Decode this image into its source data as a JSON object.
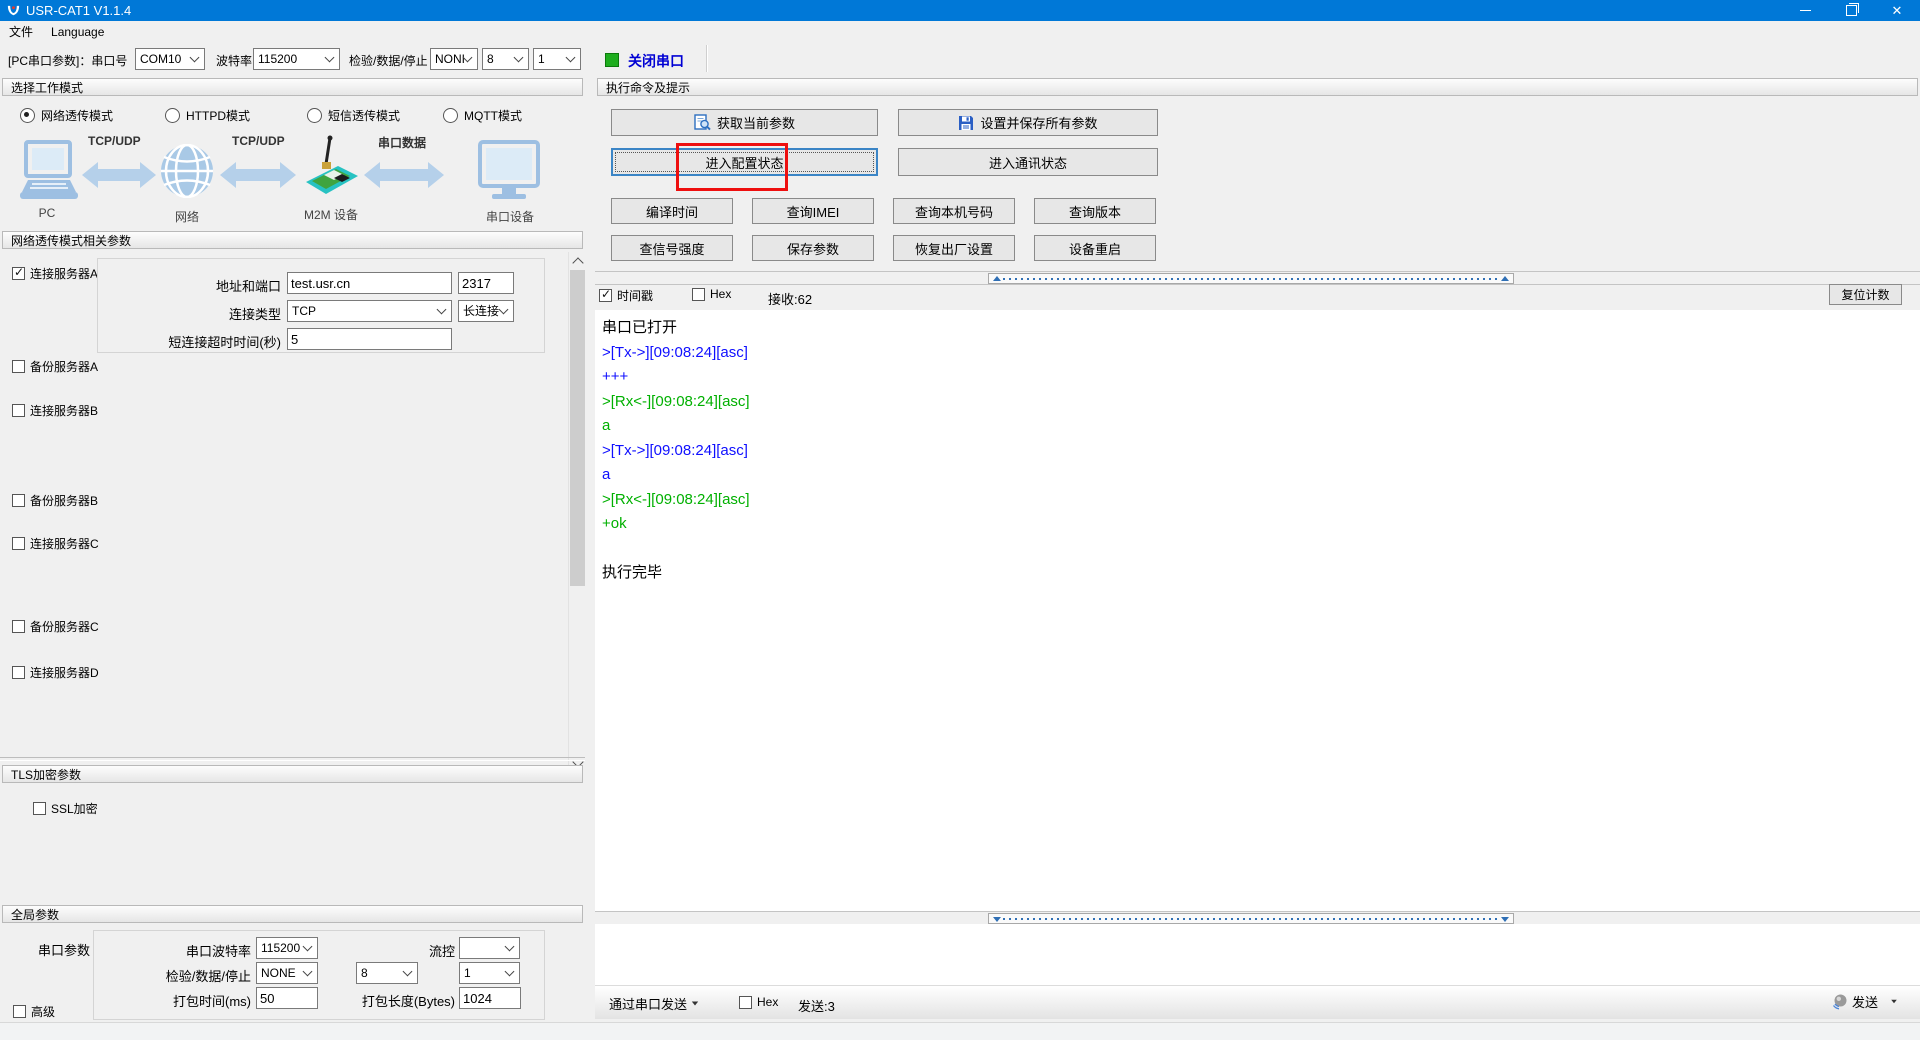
{
  "window": {
    "title": "USR-CAT1 V1.1.4"
  },
  "menu": {
    "items": [
      {
        "label": "文件"
      },
      {
        "label": "Language"
      }
    ]
  },
  "toolbar": {
    "port_label": "[PC串口参数]：串口号",
    "port_value": "COM10",
    "baud_label": "波特率",
    "baud_value": "115200",
    "parity_label": "检验/数据/停止",
    "parity_value": "NONI",
    "databits_value": "8",
    "stopbits_value": "1",
    "close_port_label": "关闭串口"
  },
  "workmode": {
    "header": "选择工作模式",
    "modes": [
      {
        "label": "网络透传模式",
        "selected": true
      },
      {
        "label": "HTTPD模式",
        "selected": false
      },
      {
        "label": "短信透传模式",
        "selected": false
      },
      {
        "label": "MQTT模式",
        "selected": false
      }
    ],
    "diagram": {
      "nodes": [
        {
          "label": "PC"
        },
        {
          "label": "网络"
        },
        {
          "label": "M2M 设备"
        },
        {
          "label": "串口设备"
        }
      ],
      "links": [
        {
          "label": "TCP/UDP"
        },
        {
          "label": "TCP/UDP"
        },
        {
          "label": "串口数据"
        }
      ]
    }
  },
  "net_params": {
    "header": "网络透传模式相关参数",
    "server_a": {
      "label": "连接服务器A",
      "checked": true,
      "addr_label": "地址和端口",
      "addr_value": "test.usr.cn",
      "port_value": "2317",
      "type_label": "连接类型",
      "type_value": "TCP",
      "keep_value": "长连接",
      "timeout_label": "短连接超时时间(秒)",
      "timeout_value": "5"
    },
    "checkboxes": [
      {
        "label": "备份服务器A",
        "checked": false
      },
      {
        "label": "连接服务器B",
        "checked": false
      },
      {
        "label": "备份服务器B",
        "checked": false
      },
      {
        "label": "连接服务器C",
        "checked": false
      },
      {
        "label": "备份服务器C",
        "checked": false
      },
      {
        "label": "连接服务器D",
        "checked": false
      }
    ]
  },
  "tls": {
    "header": "TLS加密参数",
    "ssl_label": "SSL加密",
    "ssl_checked": false
  },
  "global_params": {
    "header": "全局参数",
    "group_label": "串口参数",
    "baud_label": "串口波特率",
    "baud_value": "115200",
    "flow_label": "流控",
    "flow_value": "",
    "parity_label": "检验/数据/停止",
    "parity_value": "NONE",
    "databits_value": "8",
    "stopbits_value": "1",
    "packtime_label": "打包时间(ms)",
    "packtime_value": "50",
    "packlen_label": "打包长度(Bytes)",
    "packlen_value": "1024",
    "advanced_label": "高级",
    "advanced_checked": false
  },
  "commands": {
    "header": "执行命令及提示",
    "big_buttons": [
      {
        "label": "获取当前参数",
        "icon": "search-doc-icon"
      },
      {
        "label": "设置并保存所有参数",
        "icon": "save-icon"
      },
      {
        "label": "进入配置状态",
        "focused": true,
        "annotated": true
      },
      {
        "label": "进入通讯状态"
      }
    ],
    "small_buttons": [
      "编译时间",
      "查询IMEI",
      "查询本机号码",
      "查询版本",
      "查信号强度",
      "保存参数",
      "恢复出厂设置",
      "设备重启"
    ]
  },
  "log": {
    "timestamp_label": "时间戳",
    "timestamp_checked": true,
    "hex_label": "Hex",
    "hex_checked": false,
    "recv_label": "接收:62",
    "reset_button": "复位计数",
    "lines": [
      {
        "text": "串口已打开",
        "color": "#000000"
      },
      {
        "text": ">[Tx->][09:08:24][asc]",
        "color": "#0f0fff"
      },
      {
        "text": "+++",
        "color": "#0f0fff"
      },
      {
        "text": ">[Rx<-][09:08:24][asc]",
        "color": "#00b000"
      },
      {
        "text": "a",
        "color": "#00b000"
      },
      {
        "text": ">[Tx->][09:08:24][asc]",
        "color": "#0f0fff"
      },
      {
        "text": "a",
        "color": "#0f0fff"
      },
      {
        "text": ">[Rx<-][09:08:24][asc]",
        "color": "#00b000"
      },
      {
        "text": "+ok",
        "color": "#00b000"
      },
      {
        "text": "",
        "color": "#000000"
      },
      {
        "text": "执行完毕",
        "color": "#000000"
      }
    ]
  },
  "send": {
    "via_label": "通过串口发送",
    "hex_label": "Hex",
    "hex_checked": false,
    "sent_label": "发送:3",
    "send_button": "发送",
    "input_value": ""
  },
  "colors": {
    "titlebar": "#0078d7",
    "tx_text": "#0f0fff",
    "rx_text": "#00b000",
    "annotation": "#ee0f0f",
    "open_indicator": "#1fae1f",
    "link_text": "#0000d4",
    "diagram_blue": "#b5d0ea"
  }
}
